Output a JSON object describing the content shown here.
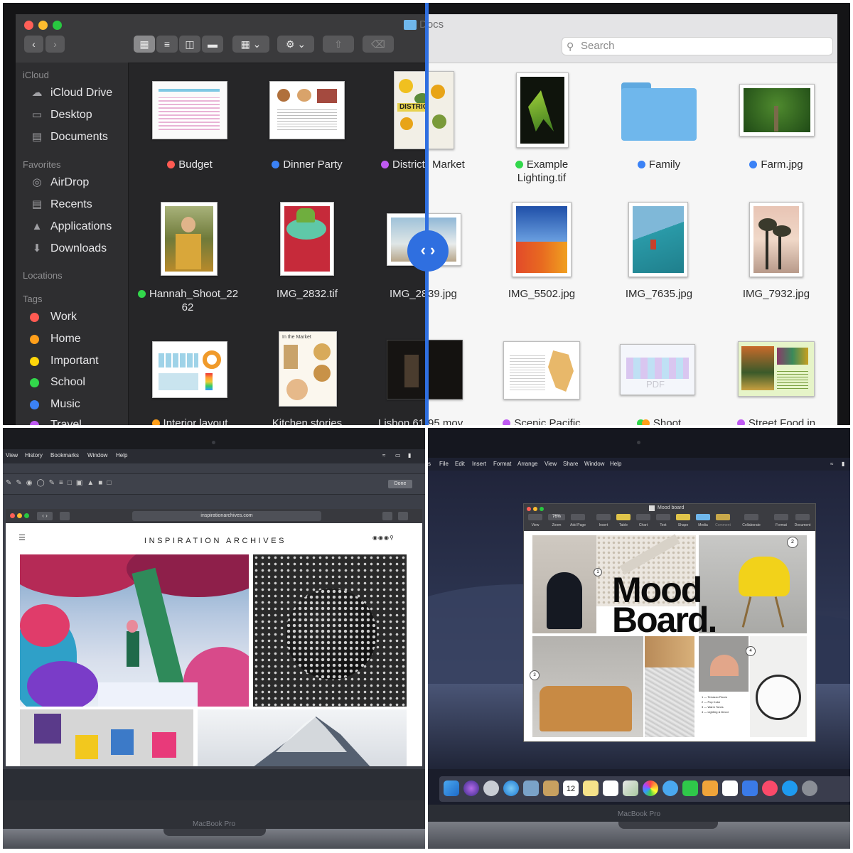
{
  "finder": {
    "window_title": "Docs",
    "search_placeholder": "Search",
    "sidebar": {
      "icloud_header": "iCloud",
      "icloud_items": [
        "iCloud Drive",
        "Desktop",
        "Documents"
      ],
      "favorites_header": "Favorites",
      "favorites_items": [
        "AirDrop",
        "Recents",
        "Applications",
        "Downloads"
      ],
      "locations_header": "Locations",
      "tags_header": "Tags",
      "tags": [
        {
          "label": "Work",
          "color": "#ff5a52"
        },
        {
          "label": "Home",
          "color": "#ff9f1a"
        },
        {
          "label": "Important",
          "color": "#ffd60a"
        },
        {
          "label": "School",
          "color": "#32d74b"
        },
        {
          "label": "Music",
          "color": "#3b82f6"
        },
        {
          "label": "Travel",
          "color": "#bf5af2"
        }
      ]
    },
    "dark_files": [
      {
        "line1": "Budget",
        "line2": "",
        "tag": "#ff5a52"
      },
      {
        "line1": "Dinner Party",
        "line2": "",
        "tag": "#3b82f6"
      },
      {
        "line1": "District",
        "line2": "",
        "tag": "#bf5af2"
      },
      {
        "line1": "Hannah_Shoot_22",
        "line2": "62",
        "tag": "#32d74b"
      },
      {
        "line1": "IMG_2832.tif",
        "line2": "",
        "tag": ""
      },
      {
        "line1": "IMG_28",
        "line2": "",
        "tag": ""
      },
      {
        "line1": "Interior layout",
        "line2": "",
        "tag": "#ff9f1a"
      },
      {
        "line1": "Kitchen stories",
        "line2": "",
        "tag": ""
      },
      {
        "line1": "Lisbon 61",
        "line2": "",
        "tag": ""
      }
    ],
    "light_files": [
      {
        "line1": "Market",
        "line2": "",
        "tag": ""
      },
      {
        "line1": "Example",
        "line2": "Lighting.tif",
        "tag": "#32d74b"
      },
      {
        "line1": "Family",
        "line2": "",
        "tag": "#3b82f6"
      },
      {
        "line1": "Farm.jpg",
        "line2": "",
        "tag": "#3b82f6"
      },
      {
        "line1": "39.jpg",
        "line2": "",
        "tag": ""
      },
      {
        "line1": "IMG_5502.jpg",
        "line2": "",
        "tag": ""
      },
      {
        "line1": "IMG_7635.jpg",
        "line2": "",
        "tag": ""
      },
      {
        "line1": "IMG_7932.jpg",
        "line2": "",
        "tag": ""
      },
      {
        "line1": "95.mov",
        "line2": "",
        "tag": ""
      },
      {
        "line1": "Scenic Pacific",
        "line2": "",
        "tag": "#bf5af2"
      },
      {
        "line1": "Shoot",
        "line2": "",
        "tag": "#ff9f1a"
      },
      {
        "line1": "Street Food in",
        "line2": "",
        "tag": "#bf5af2"
      }
    ],
    "thumb_text": {
      "district_cover": "DISTRICT",
      "kitchen_cover": "In the Market",
      "pdf_badge": "PDF"
    }
  },
  "safari_screen": {
    "menu": [
      "View",
      "History",
      "Bookmarks",
      "Window",
      "Help"
    ],
    "done_label": "Done",
    "url": "inspirationarchives.com",
    "site_title": "INSPIRATION ARCHIVES",
    "device_label": "MacBook Pro"
  },
  "pages_screen": {
    "menu": [
      "Edit",
      "File",
      "Edit",
      "Insert",
      "Format",
      "Arrange",
      "View",
      "Share",
      "Window",
      "Help"
    ],
    "window_title": "Mood board",
    "toolbar_labels": [
      "View",
      "Zoom",
      "Add Page",
      "Insert",
      "Table",
      "Chart",
      "Text",
      "Shape",
      "Media",
      "Comment",
      "Collaborate",
      "Format",
      "Document"
    ],
    "zoom_value": "76%",
    "mood_line1": "Mood",
    "mood_line2": "Board.",
    "list_items": [
      "1 — Terrazzo Floors",
      "2 — Pop Color",
      "3 — Warm Tones",
      "4 — Lighting & Decor"
    ],
    "callouts": [
      "1",
      "2",
      "3",
      "4"
    ],
    "calendar_day": "12",
    "device_label": "MacBook Pro"
  },
  "colors": {
    "divider": "#2f6fe0",
    "folder_blue": "#6fb7ec",
    "close": "#ff5f57",
    "minimize": "#febc2e",
    "zoom": "#28c840"
  }
}
